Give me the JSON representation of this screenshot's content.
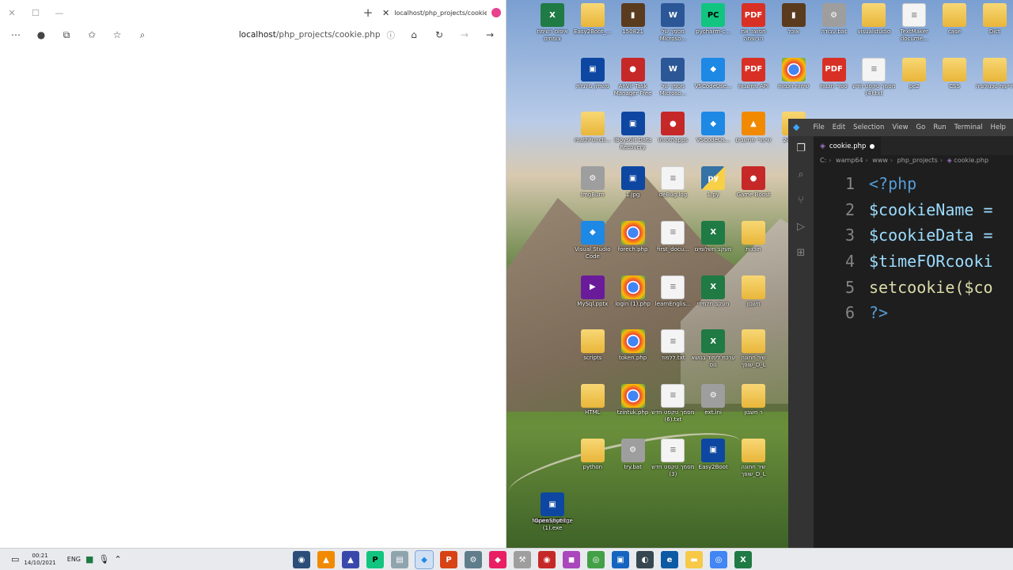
{
  "browser": {
    "tab_title": "localhost/php_projects/cookie.php",
    "address_host": "localhost",
    "address_path": "/php_projects/cookie.php",
    "window_controls": {
      "close": "✕",
      "maximize": "☐",
      "minimize": "—"
    },
    "new_tab": "+"
  },
  "desktop_icons": [
    {
      "label": "איפוס רשימת צומתים",
      "type": "excel"
    },
    {
      "label": "Easy2Boot_...",
      "type": "folder"
    },
    {
      "label": "150821",
      "type": "book"
    },
    {
      "label": "מסמך של Microso...",
      "type": "word"
    },
    {
      "label": "pycharm-c...",
      "type": "pycharm"
    },
    {
      "label": "תפוצה את הרשימה",
      "type": "pdf"
    },
    {
      "label": "אוכל",
      "type": "book"
    },
    {
      "label": "עבודה.bat",
      "type": "gear"
    },
    {
      "label": "visualstudio",
      "type": "folder"
    },
    {
      "label": "TextMaker docume...",
      "type": "doc"
    },
    {
      "label": "case",
      "type": "folder"
    },
    {
      "label": "Dict",
      "type": "folder"
    },
    {
      "label": "משחק גולגלת",
      "type": "blue"
    },
    {
      "label": "AnVir Task Manager Free",
      "type": "red"
    },
    {
      "label": "מסמך של Microso...",
      "type": "word"
    },
    {
      "label": "VSCodeUse...",
      "type": "vscode"
    },
    {
      "label": "מחשבות API",
      "type": "pdf"
    },
    {
      "label": "שיחות חכמות",
      "type": "chrome"
    },
    {
      "label": "ספרי תכנות",
      "type": "pdf"
    },
    {
      "label": "מסמך טקסט חדש (4).txt",
      "type": "doc"
    },
    {
      "label": "pc2",
      "type": "folder"
    },
    {
      "label": "CSS",
      "type": "folder"
    },
    {
      "label": "ידיעות טכנולוגיה",
      "type": "folder"
    },
    {
      "label": "mathFuncti...",
      "type": "folder"
    },
    {
      "label": "iBoysoft Data Recovery",
      "type": "blue"
    },
    {
      "label": "lnrothapps",
      "type": "red"
    },
    {
      "label": "VSCodeUs...",
      "type": "vscode"
    },
    {
      "label": "שיעורי מחשבים",
      "type": "vlc"
    },
    {
      "label": "240821",
      "type": "folder"
    },
    {
      "label": "ImgBurn",
      "type": "gear"
    },
    {
      "label": "1.jpg",
      "type": "blue"
    },
    {
      "label": "deBug.log",
      "type": "doc"
    },
    {
      "label": "1.py",
      "type": "py"
    },
    {
      "label": "Game Boost",
      "type": "red"
    },
    {
      "label": "Visual Studio Code",
      "type": "vscode"
    },
    {
      "label": "forech.php",
      "type": "chrome"
    },
    {
      "label": "first_docu...",
      "type": "doc"
    },
    {
      "label": "מעקב תשלומים",
      "type": "excel"
    },
    {
      "label": "תוכנות",
      "type": "folder"
    },
    {
      "label": "MySql.pptx",
      "type": "purple"
    },
    {
      "label": "login (1).php",
      "type": "chrome"
    },
    {
      "label": "learnEnglis...",
      "type": "doc"
    },
    {
      "label": "מעקב תלמידי",
      "type": "excel"
    },
    {
      "label": "חשבון",
      "type": "folder"
    },
    {
      "label": "scripts",
      "type": "folder"
    },
    {
      "label": "token.php",
      "type": "chrome"
    },
    {
      "label": "ללמוד.txt",
      "type": "doc"
    },
    {
      "label": "ערכת לימוד בנושא נוס",
      "type": "excel"
    },
    {
      "label": "שיר חתונה שופך_D_L",
      "type": "folder"
    },
    {
      "label": "HTML",
      "type": "folder"
    },
    {
      "label": "tzintuk.php",
      "type": "chrome"
    },
    {
      "label": "מסמך טקסט חדש (6).txt",
      "type": "doc"
    },
    {
      "label": "ext.ini",
      "type": "gear"
    },
    {
      "label": "ר חשבון",
      "type": "folder"
    },
    {
      "label": "python",
      "type": "folder"
    },
    {
      "label": "try.bat",
      "type": "gear"
    },
    {
      "label": "מסמך טקסט חדש (3)",
      "type": "doc"
    },
    {
      "label": "Easy2Boot",
      "type": "blue"
    },
    {
      "label": "שיר חתונה שופך_D_L",
      "type": "folder"
    },
    {
      "label": "Hadar python",
      "type": "folder"
    },
    {
      "label": "Microsoft Edge",
      "type": "edge"
    },
    {
      "label": "win+key.d...",
      "type": "word"
    },
    {
      "label": "OpenShot-l... (1).exe",
      "type": "blue"
    }
  ],
  "vscode": {
    "menu": [
      "File",
      "Edit",
      "Selection",
      "View",
      "Go",
      "Run",
      "Terminal",
      "Help"
    ],
    "tab_name": "cookie.php",
    "breadcrumb": [
      "C:",
      "wamp64",
      "www",
      "php_projects",
      "cookie.php"
    ],
    "lines": [
      {
        "n": "1",
        "text": "<?php"
      },
      {
        "n": "2",
        "text": "$cookieName ="
      },
      {
        "n": "3",
        "text": "$cookieData ="
      },
      {
        "n": "4",
        "text": "$timeFORcooki"
      },
      {
        "n": "5",
        "text": "setcookie($co"
      },
      {
        "n": "6",
        "text": "?>"
      }
    ]
  },
  "taskbar": {
    "time": "00:21",
    "date": "14/10/2021",
    "language": "ENG"
  }
}
